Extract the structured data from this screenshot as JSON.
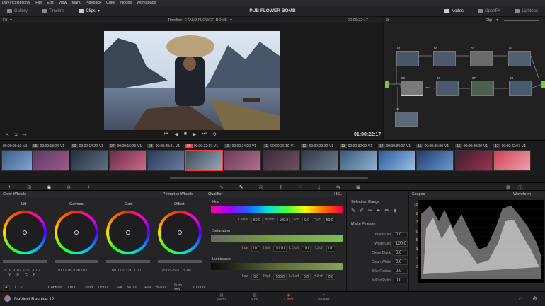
{
  "menubar": {
    "items": [
      "DaVinci Resolve",
      "File",
      "Edit",
      "View",
      "Mark",
      "Playback",
      "Color",
      "Nodes",
      "Workspace"
    ]
  },
  "topbar": {
    "title": "PUB FLOWER BOMB",
    "left_buttons": [
      "Gallery",
      "Timeline",
      "Clips"
    ],
    "right_buttons": [
      "Nodes",
      "OpenFX",
      "Lightbox"
    ]
  },
  "viewer": {
    "fit": "Fit",
    "timeline_name": "Timeline: ETALO FLOWER BOMB",
    "source_tc": "00:00:22:17",
    "playhead_tc": "01:00:22:17"
  },
  "nodes": {
    "mode": "Clip",
    "labels": [
      "01",
      "02",
      "03",
      "04",
      "05",
      "06",
      "07",
      "08",
      "09"
    ]
  },
  "timeline": {
    "clips": [
      {
        "num": "04",
        "tc": "00:00:09:10",
        "track": "V1"
      },
      {
        "num": "05",
        "tc": "00:00:13:04",
        "track": "V1"
      },
      {
        "num": "06",
        "tc": "00:00:14:20",
        "track": "V1"
      },
      {
        "num": "07",
        "tc": "00:00:16:23",
        "track": "V1"
      },
      {
        "num": "08",
        "tc": "00:00:20:21",
        "track": "V1"
      },
      {
        "num": "09",
        "tc": "00:00:22:17",
        "track": "V1"
      },
      {
        "num": "10",
        "tc": "00:00:24:20",
        "track": "V1"
      },
      {
        "num": "11",
        "tc": "00:00:26:10",
        "track": "V1"
      },
      {
        "num": "12",
        "tc": "00:00:29:22",
        "track": "V1"
      },
      {
        "num": "13",
        "tc": "00:00:32:09",
        "track": "V1"
      },
      {
        "num": "14",
        "tc": "00:00:34:07",
        "track": "V1"
      },
      {
        "num": "15",
        "tc": "00:00:36:00",
        "track": "V1"
      },
      {
        "num": "16",
        "tc": "00:00:39:00",
        "track": "V1"
      },
      {
        "num": "17",
        "tc": "00:00:42:07",
        "track": "V1"
      }
    ]
  },
  "color_wheels": {
    "panel_title": "Color Wheels",
    "mode": "Primaries Wheels",
    "wheels": [
      {
        "name": "Lift",
        "values": [
          "-0.02",
          "-0.02",
          "-0.02",
          "-0.02"
        ]
      },
      {
        "name": "Gamma",
        "values": [
          "0.00",
          "0.00",
          "0.00",
          "0.00"
        ]
      },
      {
        "name": "Gain",
        "values": [
          "1.00",
          "1.00",
          "1.00",
          "1.00"
        ]
      },
      {
        "name": "Offset",
        "values": [
          "25.00",
          "25.00",
          "25.00"
        ]
      }
    ],
    "channel_labels_lift": [
      "Y",
      "R",
      "G",
      "B"
    ],
    "contrast_label": "Contrast",
    "contrast": "1.000",
    "pivot_label": "Pivot",
    "pivot": "0.500",
    "sat_label": "Sat",
    "sat": "50.00",
    "hue_label": "Hue",
    "hue": "50.00",
    "lummix_label": "Lum Mix",
    "lummix": "100.00",
    "page_nums": [
      "A",
      "1",
      "2"
    ]
  },
  "qualifier": {
    "panel_title": "Qualifier",
    "mode": "HSL",
    "hue": {
      "label": "Hue",
      "center": "50.0",
      "width": "100.0",
      "soft": "0.0",
      "sym": "50.0"
    },
    "saturation": {
      "label": "Saturation",
      "low": "0.0",
      "high": "100.0",
      "lsoft": "0.0",
      "hsoft": "0.0"
    },
    "luminance": {
      "label": "Luminance",
      "low": "0.0",
      "high": "100.0",
      "lsoft": "0.0",
      "hsoft": "0.0"
    },
    "labels": {
      "center": "Center",
      "width": "Width",
      "soft": "Soft",
      "sym": "Sym",
      "low": "Low",
      "high": "High",
      "lsoft": "L.Soft",
      "hsoft": "H.Soft"
    }
  },
  "selection": {
    "range_title": "Selection Range",
    "matte_title": "Matte Finesse",
    "rows": [
      {
        "label": "Black Clip",
        "value": "0.0"
      },
      {
        "label": "White Clip",
        "value": "100.0"
      },
      {
        "label": "Clean Black",
        "value": "0.0"
      },
      {
        "label": "Clean White",
        "value": "0.0"
      },
      {
        "label": "Blur Radius",
        "value": "0.0"
      },
      {
        "label": "In/Out Ratio",
        "value": "0.0"
      }
    ]
  },
  "scopes": {
    "panel_title": "Scopes",
    "mode": "Waveform",
    "ticks": [
      "1023",
      "896",
      "768",
      "640",
      "512",
      "384",
      "256",
      "128",
      "0"
    ]
  },
  "bottom": {
    "app_name": "DaVinci Resolve 12",
    "pages": [
      "Media",
      "Edit",
      "Color",
      "Deliver"
    ],
    "active_page": "Color"
  },
  "colors": {
    "accent": "#e85a5a",
    "node_green": "#7cc046",
    "playhead": "#e84040"
  }
}
